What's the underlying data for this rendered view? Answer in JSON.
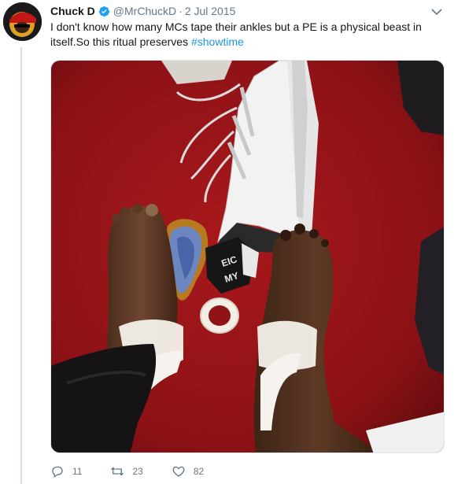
{
  "tweet": {
    "author_name": "Chuck D",
    "handle": "@MrChuckD",
    "separator": "·",
    "date": "2 Jul 2015",
    "text_main": "I don't know how many MCs tape their ankles but a PE is a physical beast in itself.So this ritual preserves ",
    "hashtag": "#showtime",
    "media": {
      "wristband_text_1": "EIC",
      "wristband_text_2": "MY"
    }
  },
  "actions": {
    "reply_count": "11",
    "retweet_count": "23",
    "like_count": "82"
  },
  "colors": {
    "link": "#1b95e0",
    "verified": "#1da1f2",
    "muted": "#657786",
    "thread_line": "#cfe3f3"
  },
  "icons": [
    "verified-badge-icon",
    "chevron-down-icon",
    "reply-icon",
    "retweet-icon",
    "like-icon"
  ]
}
